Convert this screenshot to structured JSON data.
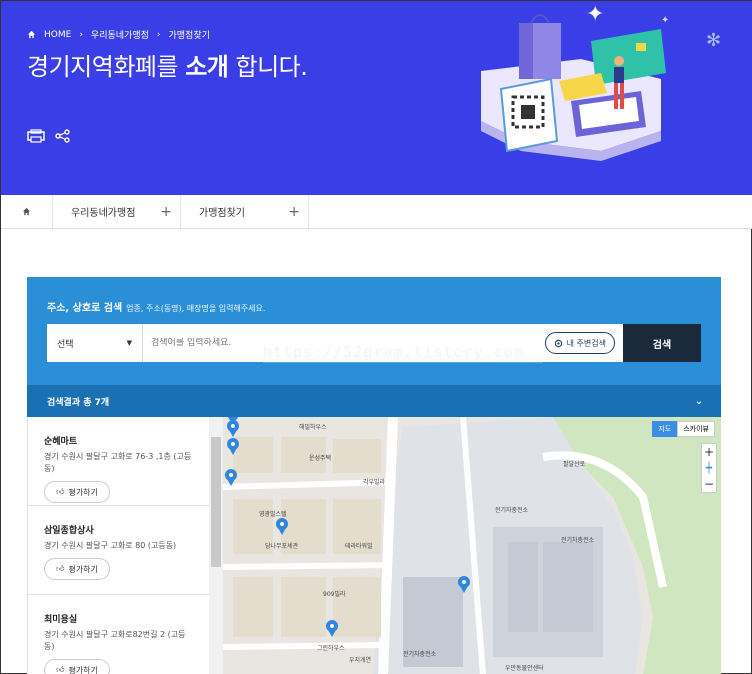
{
  "breadcrumb": {
    "home": "HOME",
    "level1": "우리동네가맹점",
    "level2": "가맹점찾기"
  },
  "hero": {
    "title_prefix": "경기지역화폐를 ",
    "title_bold": "소개",
    "title_suffix": " 합니다."
  },
  "tabs": {
    "item1": "우리동네가맹점",
    "item2": "가맹점찾기"
  },
  "search": {
    "heading": "주소, 상호로 검색",
    "hint": "업종, 주소(동명), 매장명을 입력해주세요.",
    "select_value": "선택",
    "input_placeholder": "검색어를 입력하세요.",
    "nearby_label": "내 주변검색",
    "submit_label": "검색",
    "watermark": "https://52gram.tistory.com"
  },
  "results": {
    "summary": "검색결과 총 7개",
    "rate_label": "평가하기",
    "items": [
      {
        "name": "순혜마트",
        "address": "경기 수원시 팔달구 고화로 76-3 ,1층 (고등동)"
      },
      {
        "name": "삼일종합상사",
        "address": "경기 수원시 팔달구 고화로 80 (고등동)"
      },
      {
        "name": "최미용실",
        "address": "경기 수원시 팔달구 고화로82번길 2 (고등동)"
      }
    ]
  },
  "map": {
    "toggle_map": "지도",
    "toggle_sky": "스카이뷰",
    "zoom_in": "+",
    "zoom_out": "−",
    "labels": [
      "해밀하우스",
      "운성주택",
      "각우빌라",
      "영광빌스텔",
      "당나무포세관",
      "테라타워빌",
      "909빌라",
      "그린하우스",
      "우지개연",
      "전기자충전소",
      "전기차충전소",
      "전기차충전소",
      "우만동물안센터",
      "팔달산로"
    ]
  },
  "colors": {
    "hero_bg": "#3a3ee6",
    "panel_bg": "#2a8fd6",
    "result_bar": "#1b6fb3",
    "search_btn": "#1b2a3a",
    "pin": "#2e86de"
  }
}
